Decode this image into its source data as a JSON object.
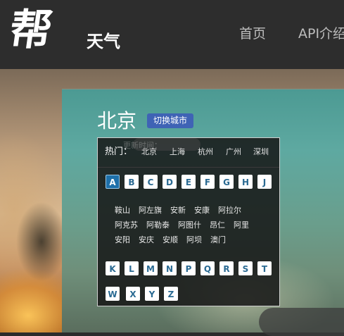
{
  "header": {
    "logo_glyph": "帮",
    "logo_sub": "天气",
    "nav": [
      {
        "label": "首页"
      },
      {
        "label": "API介绍"
      }
    ]
  },
  "city": {
    "name": "北京",
    "switch_label": "切换城市"
  },
  "dropdown": {
    "hot_label": "热门：",
    "hot_cities": [
      "北京",
      "上海",
      "杭州",
      "广州",
      "深圳"
    ],
    "ghost_text": "更新时间：",
    "letters_row1": [
      "A",
      "B",
      "C",
      "D",
      "E",
      "F",
      "G",
      "H",
      "J"
    ],
    "active_letter": "A",
    "cities_a": [
      [
        "鞍山",
        "阿左旗",
        "安新",
        "安康",
        "阿拉尔"
      ],
      [
        "阿克苏",
        "阿勒泰",
        "阿图什",
        "昂仁",
        "阿里"
      ],
      [
        "安阳",
        "安庆",
        "安顺",
        "阿坝",
        "澳门"
      ]
    ],
    "letters_row2": [
      "K",
      "L",
      "M",
      "N",
      "P",
      "Q",
      "R",
      "S",
      "T"
    ],
    "letters_row3": [
      "W",
      "X",
      "Y",
      "Z"
    ]
  },
  "colors": {
    "header_bg": "#2d2d2d",
    "switch_button": "#3f63b5",
    "active_letter": "#1e70aa",
    "letter_text": "#2a6a92"
  }
}
